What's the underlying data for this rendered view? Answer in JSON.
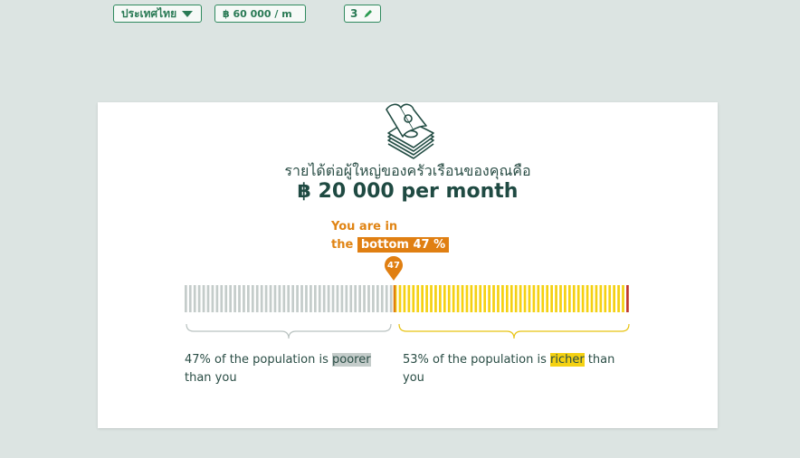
{
  "filters": {
    "country": "ประเทศไทย",
    "income": "฿ 60 000 / m",
    "household_size": "3"
  },
  "result": {
    "heading": "รายได้ต่อผู้ใหญ่ของครัวเรือนของคุณคือ",
    "amount": "฿ 20 000 per month",
    "you_are_in_1": "You are in",
    "you_are_in_2": "the",
    "rank_badge": "bottom 47 %",
    "percentile_pin": "47",
    "percentile": 47,
    "poorer_prefix": "47% of the population is",
    "poorer_word": "poorer",
    "poorer_suffix": "than you",
    "richer_prefix": "53% of the population is",
    "richer_word": "richer",
    "richer_suffix": "than you"
  },
  "colors": {
    "accent_green": "#2a7a55",
    "orange": "#e07f12",
    "poorer_grey": "#c4ccca",
    "richer_yellow": "#f4d112",
    "top_red": "#c0392b"
  }
}
